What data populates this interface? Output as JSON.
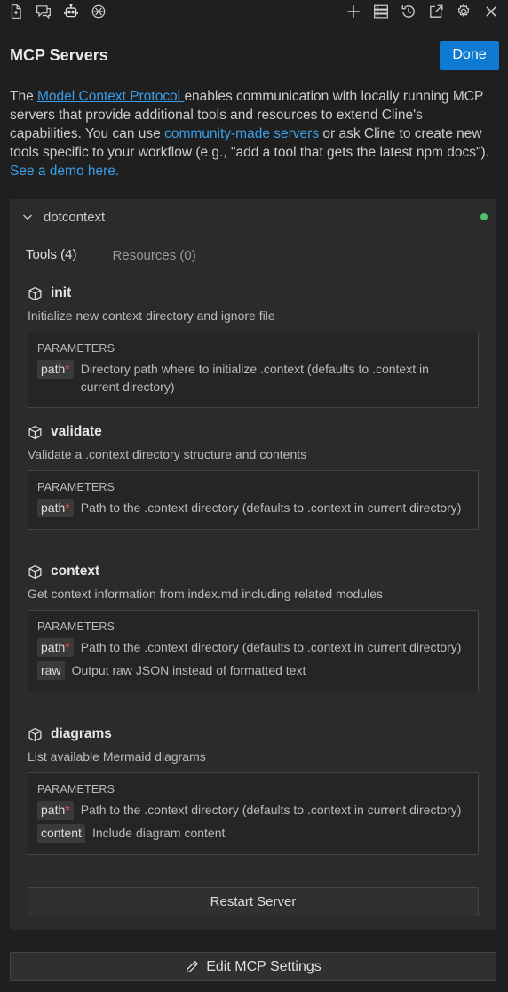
{
  "topbar": {
    "left_icons": [
      "new-file-icon",
      "chat-icon",
      "robot-icon",
      "plugin-icon"
    ],
    "right_icons": [
      "plus-icon",
      "server-icon",
      "history-icon",
      "external-link-icon",
      "gear-icon",
      "close-icon"
    ]
  },
  "header": {
    "title": "MCP Servers",
    "done_label": "Done"
  },
  "intro": {
    "t1": "The ",
    "link_mcp": "Model Context Protocol ",
    "t2": "enables communication with locally running MCP servers that provide additional tools and resources to extend Cline's capabilities. You can use ",
    "link_community": "community-made servers",
    "t3": " or ask Cline to create new tools specific to your workflow (e.g., \"add a tool that gets the latest npm docs\"). ",
    "link_demo": "See a demo here."
  },
  "server": {
    "name": "dotcontext",
    "status_color": "#4ec06b",
    "tabs": [
      {
        "label": "Tools (4)",
        "active": true
      },
      {
        "label": "Resources (0)",
        "active": false
      }
    ],
    "params_title": "PARAMETERS",
    "tools": [
      {
        "name": "init",
        "desc": "Initialize new context directory and ignore file",
        "params": [
          {
            "name": "path",
            "required": "*",
            "desc": "Directory path where to initialize .context (defaults to .context in current directory)"
          }
        ]
      },
      {
        "name": "validate",
        "desc": "Validate a .context directory structure and contents",
        "params": [
          {
            "name": "path",
            "required": "*",
            "desc": "Path to the .context directory (defaults to .context in current directory)"
          }
        ]
      },
      {
        "name": "context",
        "desc": "Get context information from index.md including related modules",
        "params": [
          {
            "name": "path",
            "required": "*",
            "desc": "Path to the .context directory (defaults to .context in current directory)"
          },
          {
            "name": "raw",
            "required": "",
            "desc": "Output raw JSON instead of formatted text"
          }
        ]
      },
      {
        "name": "diagrams",
        "desc": "List available Mermaid diagrams",
        "params": [
          {
            "name": "path",
            "required": "*",
            "desc": "Path to the .context directory (defaults to .context in current directory)"
          },
          {
            "name": "content",
            "required": "",
            "desc": "Include diagram content"
          }
        ]
      }
    ],
    "restart_label": "Restart Server"
  },
  "footer": {
    "edit_label": "Edit MCP Settings"
  },
  "colors": {
    "accent": "#0e7ad1",
    "link": "#3b9ee8",
    "required": "#f14c4c"
  }
}
